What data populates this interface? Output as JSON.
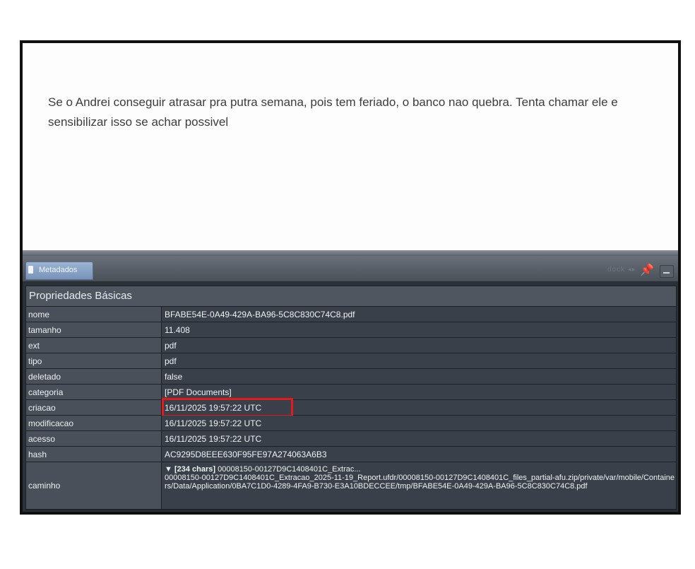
{
  "note": {
    "text": "Se o Andrei conseguir atrasar pra putra semana, pois tem feriado, o banco nao quebra. Tenta chamar ele e sensibilizar isso se achar possivel"
  },
  "tabbar": {
    "tab_label": "Metadados",
    "faded_label": "dock ◂▸",
    "pin_icon": "pin-icon",
    "minimize_icon": "minimize-icon"
  },
  "properties": {
    "section_title": "Propriedades Básicas",
    "rows": [
      {
        "key": "nome",
        "value": "BFABE54E-0A49-429A-BA96-5C8C830C74C8.pdf"
      },
      {
        "key": "tamanho",
        "value": "11.408"
      },
      {
        "key": "ext",
        "value": "pdf"
      },
      {
        "key": "tipo",
        "value": "pdf"
      },
      {
        "key": "deletado",
        "value": "false"
      },
      {
        "key": "categoria",
        "value": "[PDF Documents]"
      },
      {
        "key": "criacao",
        "value": "16/11/2025 19:57:22 UTC",
        "highlighted": true
      },
      {
        "key": "modificacao",
        "value": "16/11/2025 19:57:22 UTC"
      },
      {
        "key": "acesso",
        "value": "16/11/2025 19:57:22 UTC"
      },
      {
        "key": "hash",
        "value": "AC9295D8EEE630F95FE97A274063A6B3"
      }
    ],
    "path": {
      "key": "caminho",
      "summary": "▼ [234 chars]",
      "summary_rest": " 00008150-00127D9C1408401C_Extrac...",
      "full": "00008150-00127D9C1408401C_Extracao_2025-11-19_Report.ufdr/00008150-00127D9C1408401C_files_partial-afu.zip/private/var/mobile/Containers/Data/Application/0BA7C1D0-4289-4FA9-B730-E3A10BDECCEE/tmp/BFABE54E-0A49-429A-BA96-5C8C830C74C8.pdf"
    },
    "highlight_color": "#e11b1b"
  }
}
